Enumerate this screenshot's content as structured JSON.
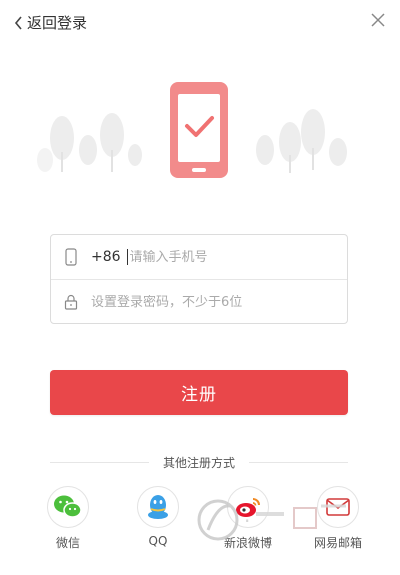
{
  "header": {
    "back_label": "返回登录"
  },
  "form": {
    "country_code": "+86",
    "phone_placeholder": "请输入手机号",
    "password_placeholder": "设置登录密码，不少于6位"
  },
  "actions": {
    "register_label": "注册"
  },
  "other": {
    "divider_label": "其他注册方式",
    "options": [
      {
        "label": "微信"
      },
      {
        "label": "QQ"
      },
      {
        "label": "新浪微博"
      },
      {
        "label": "网易邮箱"
      }
    ]
  },
  "colors": {
    "accent": "#e9474a",
    "phone_icon": "#f28b8b",
    "wechat": "#4cbf3c",
    "qq": "#3aa0e6",
    "weibo": "#e6162d"
  },
  "icons": {
    "back": "chevron-left-icon",
    "close": "close-icon",
    "hero": "phone-check-icon",
    "phone_field": "mobile-phone-icon",
    "password_field": "lock-icon"
  }
}
